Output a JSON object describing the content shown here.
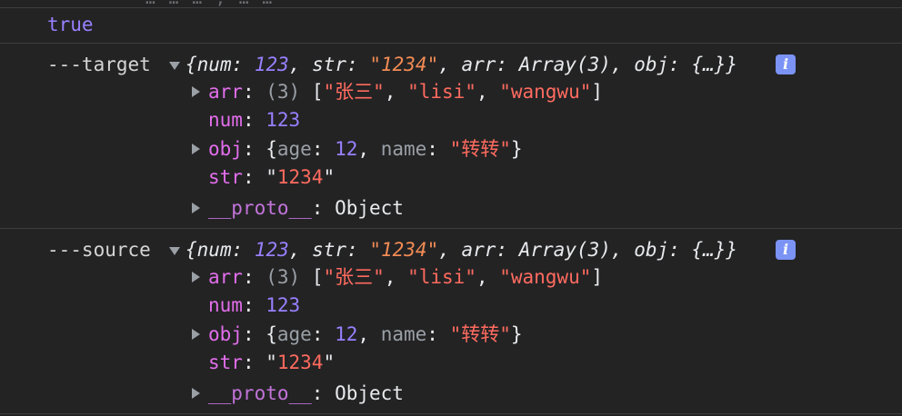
{
  "clipped_top_text": "…  …  …  ,  …  …",
  "true_line": "true",
  "messages": [
    {
      "label": "---target",
      "preview": {
        "open": "{",
        "num_key": "num",
        "num_val": "123",
        "str_key": "str",
        "str_val": "\"1234\"",
        "arr_key": "arr",
        "arr_val": "Array(3)",
        "obj_key": "obj",
        "obj_val": "{…}",
        "close": "}"
      },
      "info_icon": "i",
      "props": {
        "arr_key": "arr",
        "arr_len": "(3)",
        "arr_items": [
          "\"张三\"",
          "\"lisi\"",
          "\"wangwu\""
        ],
        "num_key": "num",
        "num_val": "123",
        "obj_key": "obj",
        "obj_age_key": "age",
        "obj_age_val": "12",
        "obj_name_key": "name",
        "obj_name_val": "\"转转\"",
        "str_key": "str",
        "str_val": "1234",
        "proto_key": "__proto__",
        "proto_val": "Object"
      }
    },
    {
      "label": "---source",
      "preview": {
        "open": "{",
        "num_key": "num",
        "num_val": "123",
        "str_key": "str",
        "str_val": "\"1234\"",
        "arr_key": "arr",
        "arr_val": "Array(3)",
        "obj_key": "obj",
        "obj_val": "{…}",
        "close": "}"
      },
      "info_icon": "i",
      "props": {
        "arr_key": "arr",
        "arr_len": "(3)",
        "arr_items": [
          "\"张三\"",
          "\"lisi\"",
          "\"wangwu\""
        ],
        "num_key": "num",
        "num_val": "123",
        "obj_key": "obj",
        "obj_age_key": "age",
        "obj_age_val": "12",
        "obj_name_key": "name",
        "obj_name_val": "\"转转\"",
        "str_key": "str",
        "str_val": "1234",
        "proto_key": "__proto__",
        "proto_val": "Object"
      }
    }
  ],
  "colors": {
    "background": "#232324",
    "key": "#e36eec",
    "number": "#9980ff",
    "string": "#f28b54",
    "info_badge": "#7b93f5"
  }
}
